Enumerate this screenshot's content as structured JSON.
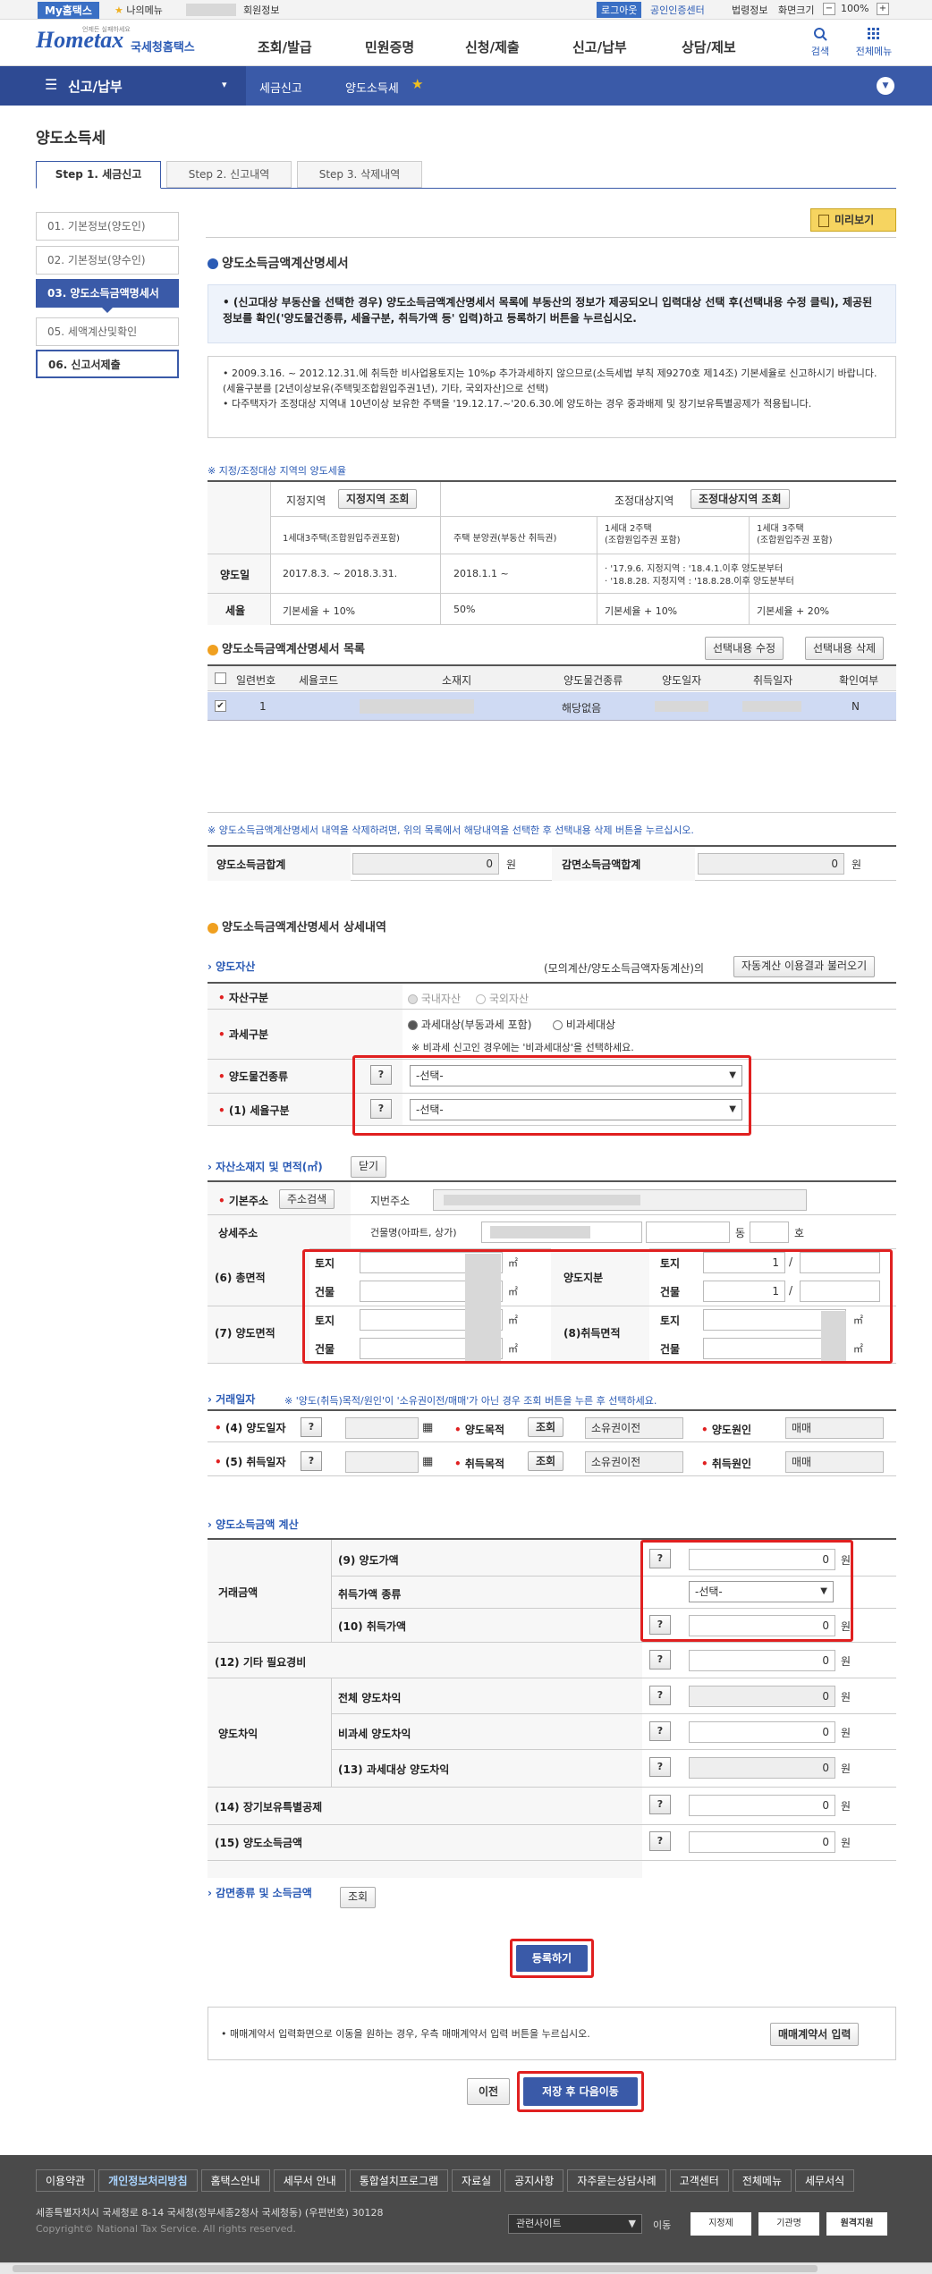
{
  "top": {
    "mytax": "My홈택스",
    "fav": "나의메뉴",
    "member": "회원정보",
    "logout": "로그아웃",
    "cert": "공인인증센터",
    "law": "법령정보",
    "zoom_label": "화면크기",
    "zoom": "100%",
    "minus": "−",
    "plus": "+"
  },
  "brand": {
    "logo": "Hometax",
    "name": "국세청홈택스",
    "tagline": "언제든 실패하세요"
  },
  "menu": [
    "조회/발급",
    "민원증명",
    "신청/제출",
    "신고/납부",
    "상담/제보"
  ],
  "util": {
    "search": "검색",
    "all": "전체메뉴"
  },
  "nav": {
    "menu_icon": "☰",
    "section": "신고/납부",
    "crumb1": "세금신고",
    "crumb2": "양도소득세",
    "star": "★",
    "down": "▼",
    "arrow": "▾"
  },
  "page_title": "양도소득세",
  "tabs": [
    "Step 1. 세금신고",
    "Step 2. 신고내역",
    "Step 3. 삭제내역"
  ],
  "side": [
    "01. 기본정보(양도인)",
    "02. 기본정보(양수인)",
    "03. 양도소득금액명세서",
    "05. 세액계산및확인",
    "06. 신고서제출"
  ],
  "preview": "미리보기",
  "main_title": "양도소득금액계산명세서",
  "info1": "• (신고대상 부동산을 선택한 경우) 양도소득금액계산명세서 목록에 부동산의 정보가 제공되오니 입력대상 선택 후(선택내용 수정 클릭), 제공된 정보를 확인('양도물건종류, 세율구분, 취득가액 등' 입력)하고 등록하기 버튼을 누르십시오.",
  "info2a": "• 2009.3.16. ~ 2012.12.31.에 취득한 비사업용토지는 10%p 추가과세하지 않으므로(소득세법 부칙 제9270호 제14조) 기본세율로 신고하시기 바랍니다. (세율구분를 [2년이상보유(주택및조합원입주권1년), 기타, 국외자산]으로 선택)",
  "info2b": "• 다주택자가 조정대상 지역내 10년이상 보유한 주택을 '19.12.17.~'20.6.30.에 양도하는 경우 중과배제 및 장기보유특별공제가 적용됩니다.",
  "rate_note": "※ 지정/조정대상 지역의 양도세율",
  "rate_table": {
    "h1": "지정지역",
    "h1btn": "지정지역 조회",
    "h2": "조정대상지역",
    "h2btn": "조정대상지역 조회",
    "s1": "1세대3주택(조합원입주권포함)",
    "s2": "주택 분양권(부동산 취득권)",
    "s3": "1세대 2주택\n(조합원입주권 포함)",
    "s4": "1세대 3주택\n(조합원입주권 포함)",
    "r1": "양도일",
    "r1c1": "2017.8.3. ~ 2018.3.31.",
    "r1c2": "2018.1.1 ~",
    "r1c3a": "· '17.9.6. 지정지역 : '18.4.1.이후 양도분부터",
    "r1c3b": "· '18.8.28. 지정지역 : '18.8.28.이후 양도분부터",
    "r2": "세율",
    "r2c1": "기본세율 + 10%",
    "r2c2": "50%",
    "r2c3": "기본세율 + 10%",
    "r2c4": "기본세율 + 20%"
  },
  "list_title": "양도소득금액계산명세서 목록",
  "list_btn1": "선택내용 수정",
  "list_btn2": "선택내용 삭제",
  "list_headers": [
    "일련번호",
    "세율코드",
    "소재지",
    "양도물건종류",
    "양도일자",
    "취득일자",
    "확인여부"
  ],
  "list_row": {
    "no": "1",
    "kind": "해당없음",
    "chk": "N",
    "checkmark": "✔"
  },
  "delete_note": "※ 양도소득금액계산명세서 내역을 삭제하려면, 위의 목록에서 해당내역을 선택한 후 선택내용 삭제 버튼을 누르십시오.",
  "sum": {
    "l1": "양도소득금합계",
    "v1": "0",
    "u": "원",
    "l2": "감면소득금액합계",
    "v2": "0"
  },
  "detail_title": "양도소득금액계산명세서 상세내역",
  "asset": {
    "title": "양도자산",
    "mock": "(모의계산/양도소득금액자동계산)의",
    "mock_btn": "자동계산 이용결과 불러오기",
    "l1": "자산구분",
    "r1a": "국내자산",
    "r1b": "국외자산",
    "l2": "과세구분",
    "r2a": "과세대상(부동과세 포함)",
    "r2b": "비과세대상",
    "r2note": "※ 비과세 신고인 경우에는 '비과세대상'을 선택하세요.",
    "l3": "양도물건종류",
    "l4": "(1) 세율구분",
    "sel": "-선택-",
    "q": "?"
  },
  "loc": {
    "title": "자산소재지 및 면적(㎡)",
    "close": "닫기",
    "l1": "기본주소",
    "btn": "주소검색",
    "addr": "지번주소",
    "l2": "상세주소",
    "bld": "건물명(아파트, 상가)",
    "dong": "동",
    "ho": "호",
    "l6": "(6) 총면적",
    "land": "토지",
    "bldg": "건물",
    "unit": "㎡",
    "ls": "양도지분",
    "one": "1",
    "slash": "/",
    "l7": "(7) 양도면적",
    "l8": "(8)취득면적"
  },
  "deal": {
    "title": "거래일자",
    "note": "※ '양도(취득)목적/원인'이 '소유권이전/매매'가 아닌 경우 조회 버튼을 누른 후 선택하세요.",
    "l4": "(4) 양도일자",
    "l5": "(5) 취득일자",
    "p1": "양도목적",
    "p2": "취득목적",
    "lookup": "조회",
    "own": "소유권이전",
    "c1": "양도원인",
    "c2": "취득원인",
    "sale": "매매",
    "cal": "▦"
  },
  "calc": {
    "title": "양도소득금액 계산",
    "g1": "거래금액",
    "l9": "(9) 양도가액",
    "lk": "취득가액 종류",
    "l10": "(10) 취득가액",
    "l12": "(12) 기타 필요경비",
    "g2": "양도차익",
    "lt": "전체 양도차익",
    "ln": "비과세 양도차익",
    "l13": "(13) 과세대상 양도차익",
    "l14": "(14) 장기보유특별공제",
    "l15": "(15) 양도소득금액",
    "zero": "0",
    "won": "원",
    "sel": "-선택-"
  },
  "reduce": {
    "title": "감면종류 및 소득금액",
    "btn": "조회"
  },
  "register": "등록하기",
  "contract_note": "• 매매계약서 입력화면으로 이동을 원하는 경우, 우측 매매계약서 입력 버튼을 누르십시오.",
  "contract_btn": "매매계약서 입력",
  "prev": "이전",
  "next": "저장 후 다음이동",
  "footer": {
    "items": [
      "이용약관",
      "개인정보처리방침",
      "홈택스안내",
      "세무서 안내",
      "통합설치프로그램",
      "자료실",
      "공지사항",
      "자주묻는상담사례",
      "고객센터",
      "전체메뉴",
      "세무서식"
    ],
    "addr": "세종특별자치시 국세청로 8-14 국세청(정부세종2청사 국세청동) (우편번호) 30128",
    "copy": "Copyright© National Tax Service. All rights reserved.",
    "related": "관련사이트",
    "go": "이동",
    "logo1": "지정제",
    "logo2": "기관명",
    "logo3": "원격지원"
  }
}
